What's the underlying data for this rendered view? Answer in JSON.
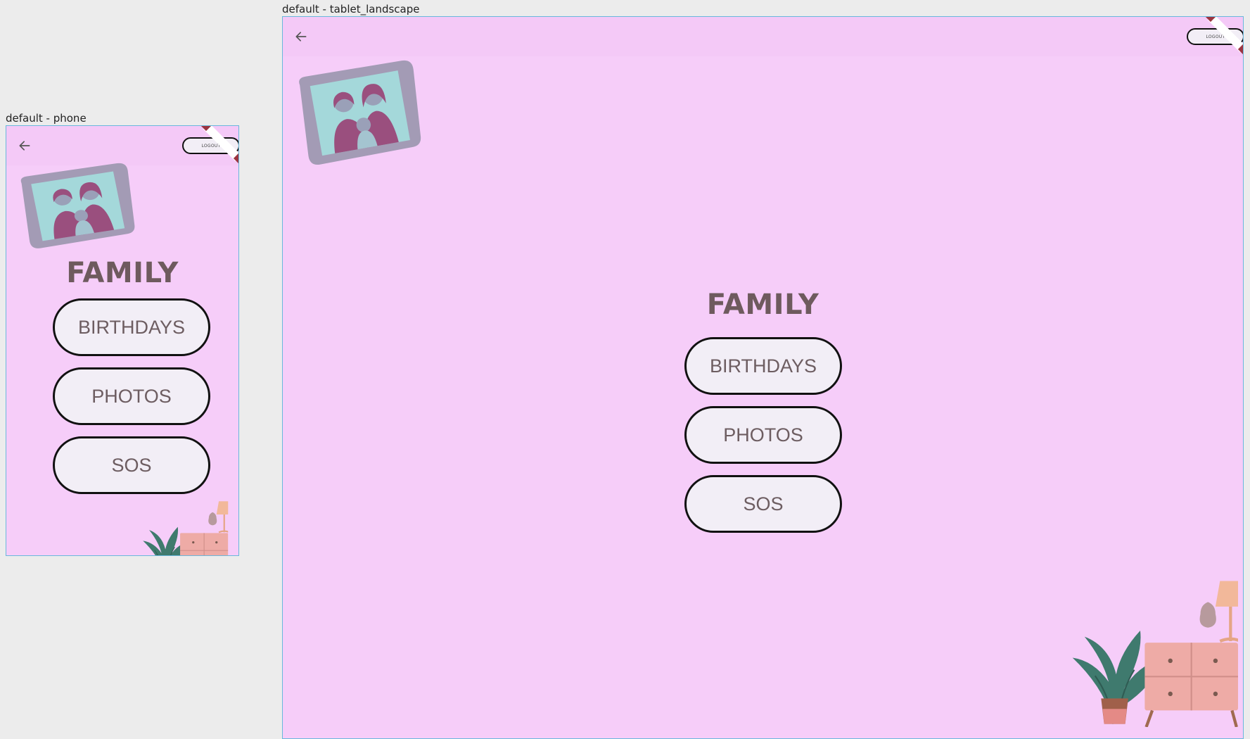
{
  "devices": {
    "phone": {
      "label": "default - phone"
    },
    "tablet": {
      "label": "default - tablet_landscape"
    }
  },
  "app": {
    "logout_label": "LOGOUT",
    "title": "FAMILY",
    "buttons": {
      "birthdays": "BIRTHDAYS",
      "photos": "PHOTOS",
      "sos": "SOS"
    }
  },
  "colors": {
    "background": "#f6cdf9",
    "appbar": "#f4c9f7",
    "button_fill": "#f2eef6",
    "button_border": "#111111",
    "title_text": "#6e5a5e",
    "debug_banner": "#9b3440"
  },
  "icons": {
    "back": "arrow-left-icon",
    "photo": "family-photo-frame",
    "decor": "plant-dresser-lamp-illustration"
  }
}
